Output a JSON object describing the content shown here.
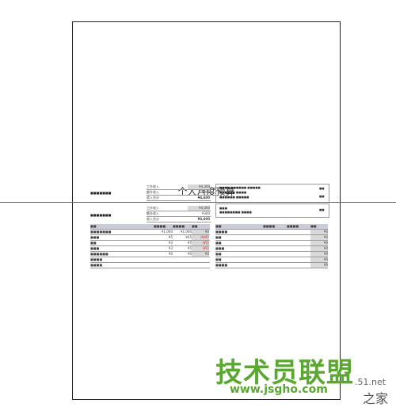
{
  "title": "个人月度预算",
  "income_labels": [
    "工作收入",
    "额外收入",
    "收入合计"
  ],
  "income1_values": [
    "¥4,300",
    "¥300",
    "¥4,600"
  ],
  "income2_values": [
    "¥4,300",
    "¥300",
    "¥4,600"
  ],
  "expense_head": [
    "¥1,000",
    "¥1,000",
    "¥0"
  ],
  "expense_rows": [
    {
      "a": "¥5",
      "b": "¥45",
      "c": "(¥40)"
    },
    {
      "a": "¥3",
      "b": "¥5",
      "c": "(¥2)"
    },
    {
      "a": "¥3",
      "b": "¥5",
      "c": "(¥2)"
    },
    {
      "a": "¥0",
      "b": "¥0",
      "c": "¥0"
    },
    {
      "a": "",
      "b": "",
      "c": ""
    },
    {
      "a": "",
      "b": "",
      "c": ""
    }
  ],
  "right_col_values": [
    "¥0",
    "¥0",
    "¥0",
    "¥0",
    "¥0",
    "¥0",
    "¥0"
  ],
  "watermark_main": "技术员联盟",
  "watermark_url": "www.jsgho.com",
  "watermark_side": ".51.net",
  "watermark_side2": "之家"
}
